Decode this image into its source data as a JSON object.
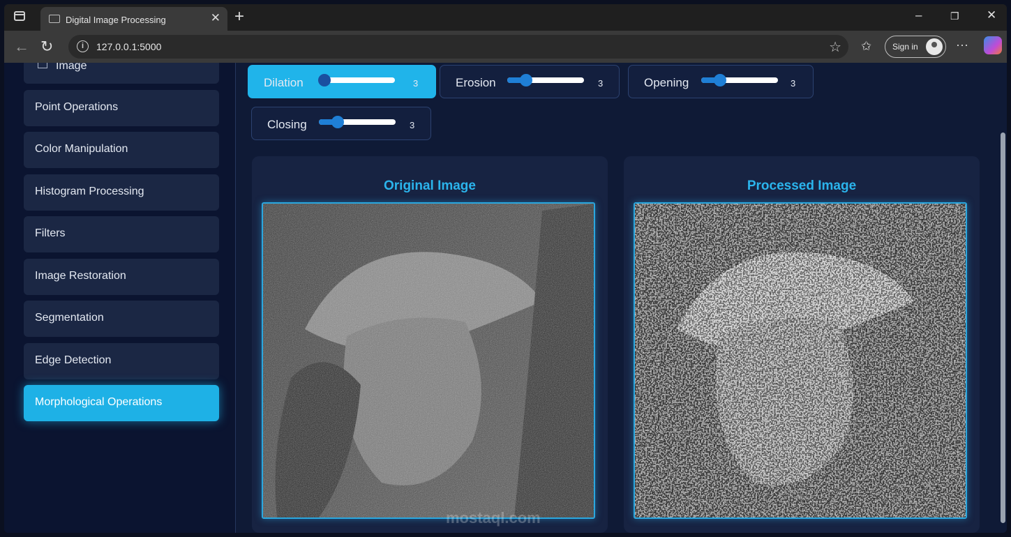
{
  "browser": {
    "tab_title": "Digital Image Processing",
    "url": "127.0.0.1:5000",
    "sign_in_label": "Sign in",
    "new_tab": "+",
    "tab_close": "✕",
    "controls": {
      "minimize": "–",
      "maximize": "❐",
      "close": "✕"
    }
  },
  "sidebar": {
    "items": [
      {
        "label": "Image",
        "active": false
      },
      {
        "label": "Point Operations",
        "active": false
      },
      {
        "label": "Color Manipulation",
        "active": false
      },
      {
        "label": "Histogram Processing",
        "active": false
      },
      {
        "label": "Filters",
        "active": false
      },
      {
        "label": "Image Restoration",
        "active": false
      },
      {
        "label": "Segmentation",
        "active": false
      },
      {
        "label": "Edge Detection",
        "active": false
      },
      {
        "label": "Morphological Operations",
        "active": true
      }
    ]
  },
  "operations": [
    {
      "label": "Dilation",
      "value": "3",
      "level": 0.0,
      "active": true
    },
    {
      "label": "Erosion",
      "value": "3",
      "level": 0.2,
      "active": false
    },
    {
      "label": "Opening",
      "value": "3",
      "level": 0.2,
      "active": false
    },
    {
      "label": "Closing",
      "value": "3",
      "level": 0.2,
      "active": false
    }
  ],
  "panels": {
    "original_title": "Original Image",
    "processed_title": "Processed Image"
  },
  "watermark": "mostaql.com",
  "colors": {
    "accent": "#1eb1e6",
    "panel_title": "#2bb4ec",
    "background": "#0f1a36"
  }
}
